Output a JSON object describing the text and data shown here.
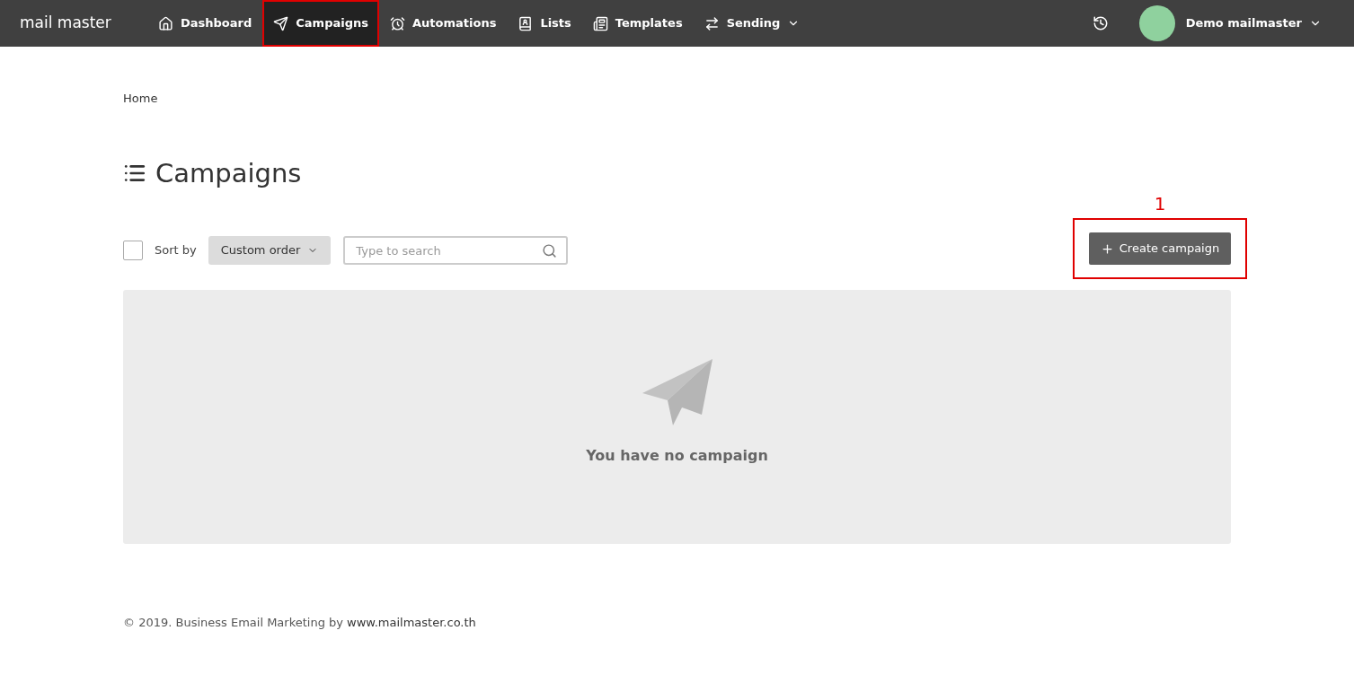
{
  "header": {
    "logo": "mail master",
    "nav": [
      {
        "label": "Dashboard",
        "selected": false,
        "highlighted": false,
        "dropdown": false
      },
      {
        "label": "Campaigns",
        "selected": true,
        "highlighted": true,
        "dropdown": false
      },
      {
        "label": "Automations",
        "selected": false,
        "highlighted": false,
        "dropdown": false
      },
      {
        "label": "Lists",
        "selected": false,
        "highlighted": false,
        "dropdown": false
      },
      {
        "label": "Templates",
        "selected": false,
        "highlighted": false,
        "dropdown": false
      },
      {
        "label": "Sending",
        "selected": false,
        "highlighted": false,
        "dropdown": true
      }
    ],
    "user": {
      "name": "Demo mailmaster"
    }
  },
  "breadcrumb": "Home",
  "page_title": "Campaigns",
  "toolbar": {
    "select_all_checked": false,
    "sort_label": "Sort by",
    "sort_value": "Custom order",
    "search": {
      "placeholder": "Type to search"
    },
    "create_button": {
      "label": "Create campaign",
      "highlighted": true,
      "step": "1"
    }
  },
  "empty_state": {
    "message": "You have no campaign"
  },
  "footer": {
    "text": "© 2019. Business Email Marketing by",
    "link": "www.mailmaster.co.th"
  }
}
